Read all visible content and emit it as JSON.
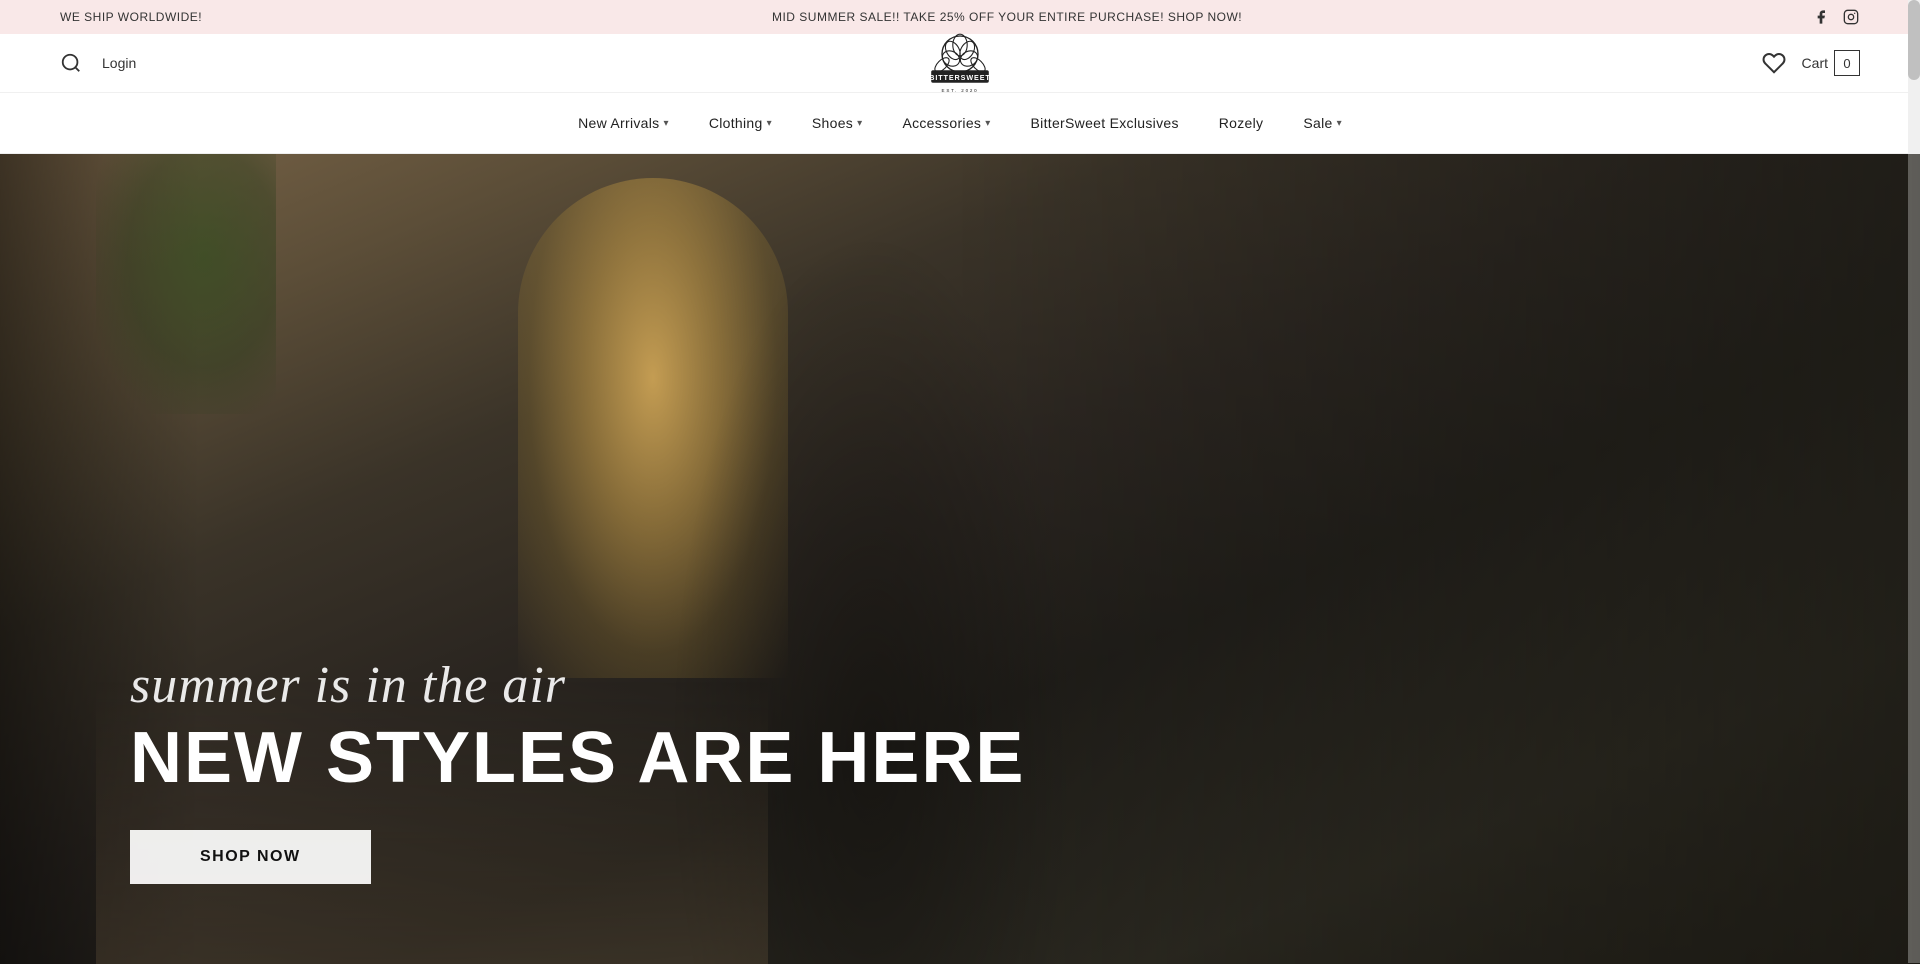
{
  "announcement": {
    "shipping_text": "WE SHIP WORLDWIDE!",
    "sale_text": "MID SUMMER SALE!! TAKE 25% OFF YOUR ENTIRE PURCHASE! SHOP NOW!",
    "social_facebook": "facebook",
    "social_instagram": "instagram"
  },
  "header": {
    "login_label": "Login",
    "cart_label": "Cart",
    "cart_count": "0",
    "logo_alt": "BitterSweet"
  },
  "nav": {
    "items": [
      {
        "label": "New Arrivals",
        "has_dropdown": true
      },
      {
        "label": "Clothing",
        "has_dropdown": true
      },
      {
        "label": "Shoes",
        "has_dropdown": true
      },
      {
        "label": "Accessories",
        "has_dropdown": true
      },
      {
        "label": "BitterSweet Exclusives",
        "has_dropdown": false
      },
      {
        "label": "Rozely",
        "has_dropdown": false
      },
      {
        "label": "Sale",
        "has_dropdown": true
      }
    ]
  },
  "hero": {
    "script_text": "summer is in the air",
    "headline": "NEW STYLES ARE HERE",
    "shop_now": "SHOP NOW"
  }
}
